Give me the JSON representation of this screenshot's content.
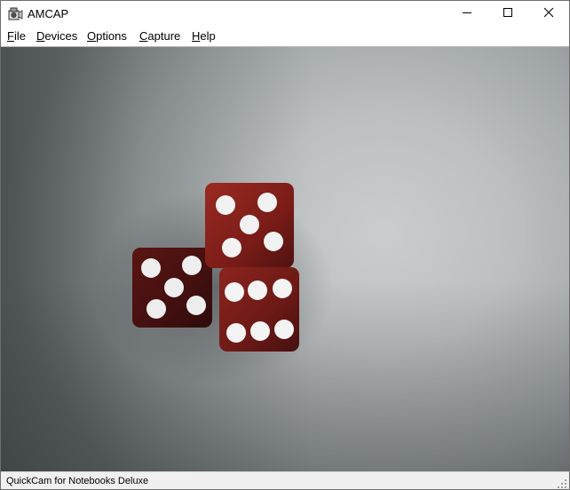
{
  "window": {
    "title": "AMCAP",
    "icon": "amcap-camera-icon",
    "controls": {
      "minimize_icon": "minimize-icon",
      "maximize_icon": "maximize-icon",
      "close_icon": "close-icon"
    }
  },
  "menu": {
    "items": [
      {
        "label_mnemonic": "F",
        "label_rest": "ile"
      },
      {
        "label_mnemonic": "D",
        "label_rest": "evices"
      },
      {
        "label_mnemonic": "O",
        "label_rest": "ptions"
      },
      {
        "label_mnemonic": "C",
        "label_rest": "apture"
      },
      {
        "label_mnemonic": "H",
        "label_rest": "elp"
      }
    ]
  },
  "preview": {
    "content": "video-preview",
    "dice_color": "#7a1a16",
    "pip_color": "#f4f4f4"
  },
  "status": {
    "device_name": "QuickCam for Notebooks Deluxe"
  }
}
